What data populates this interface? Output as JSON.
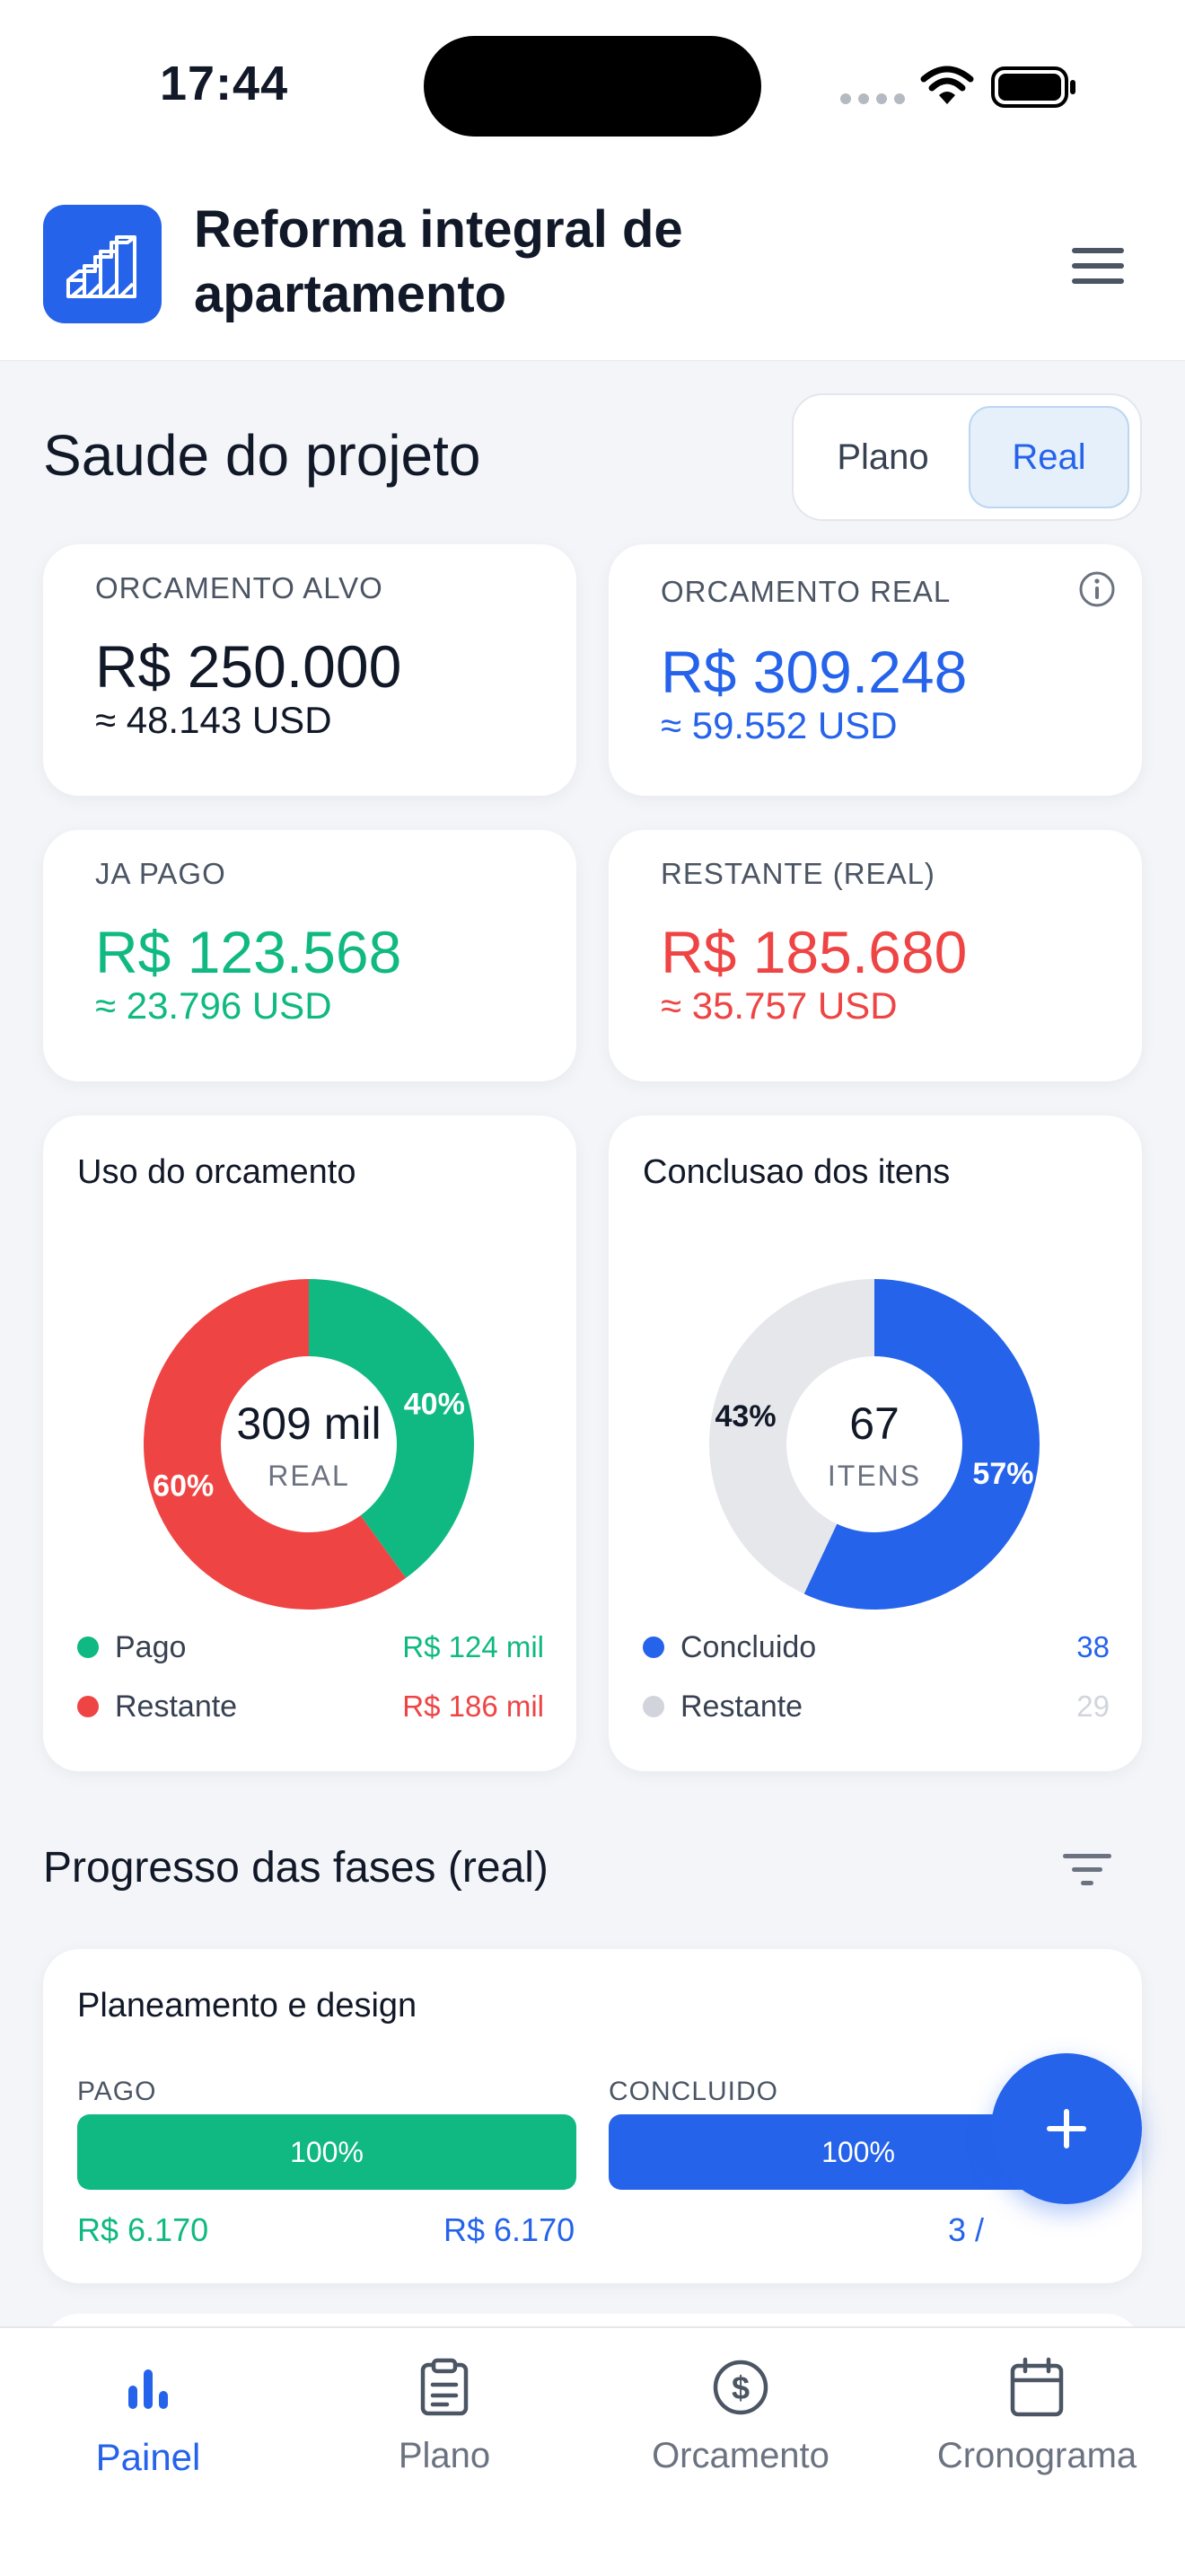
{
  "status": {
    "time": "17:44"
  },
  "header": {
    "title": "Reforma integral de apartamento"
  },
  "health": {
    "title": "Saude do projeto",
    "toggle": {
      "plan": "Plano",
      "real": "Real",
      "selected": "Real"
    }
  },
  "kpis": {
    "target": {
      "label": "ORCAMENTO ALVO",
      "value": "R$ 250.000",
      "sub": "≈ 48.143 USD"
    },
    "real": {
      "label": "ORCAMENTO REAL",
      "value": "R$ 309.248",
      "sub": "≈ 59.552 USD"
    },
    "paid": {
      "label": "JA PAGO",
      "value": "R$ 123.568",
      "sub": "≈ 23.796 USD"
    },
    "remaining": {
      "label": "RESTANTE (REAL)",
      "value": "R$ 185.680",
      "sub": "≈ 35.757 USD"
    }
  },
  "budget_chart": {
    "title": "Uso do orcamento",
    "center_value": "309 mil",
    "center_label": "REAL",
    "slices": [
      {
        "name": "Pago",
        "percent": 40,
        "label": "40%",
        "amount": "R$ 124 mil",
        "color": "#10b981"
      },
      {
        "name": "Restante",
        "percent": 60,
        "label": "60%",
        "amount": "R$ 186 mil",
        "color": "#ef4444"
      }
    ]
  },
  "items_chart": {
    "title": "Conclusao dos itens",
    "center_value": "67",
    "center_label": "ITENS",
    "slices": [
      {
        "name": "Concluido",
        "percent": 57,
        "label": "57%",
        "amount": "38",
        "color": "#2563eb"
      },
      {
        "name": "Restante",
        "percent": 43,
        "label": "43%",
        "amount": "29",
        "color": "#e5e7eb"
      }
    ]
  },
  "phases": {
    "title": "Progresso das fases (real)",
    "items": [
      {
        "name": "Planeamento e design",
        "paid_label": "PAGO",
        "paid_percent": 100,
        "paid_percent_text": "100%",
        "paid_amount": "R$ 6.170",
        "total_amount": "R$ 6.170",
        "done_label": "CONCLUIDO",
        "done_percent": 100,
        "done_percent_text": "100%",
        "done_count": "3 /"
      }
    ]
  },
  "nav": [
    {
      "label": "Painel",
      "icon": "bar-chart-icon",
      "active": true
    },
    {
      "label": "Plano",
      "icon": "clipboard-icon",
      "active": false
    },
    {
      "label": "Orcamento",
      "icon": "dollar-circle-icon",
      "active": false
    },
    {
      "label": "Cronograma",
      "icon": "calendar-icon",
      "active": false
    }
  ],
  "colors": {
    "accent": "#2563eb",
    "green": "#10b981",
    "red": "#ef4444",
    "background": "#f3f5f9"
  }
}
